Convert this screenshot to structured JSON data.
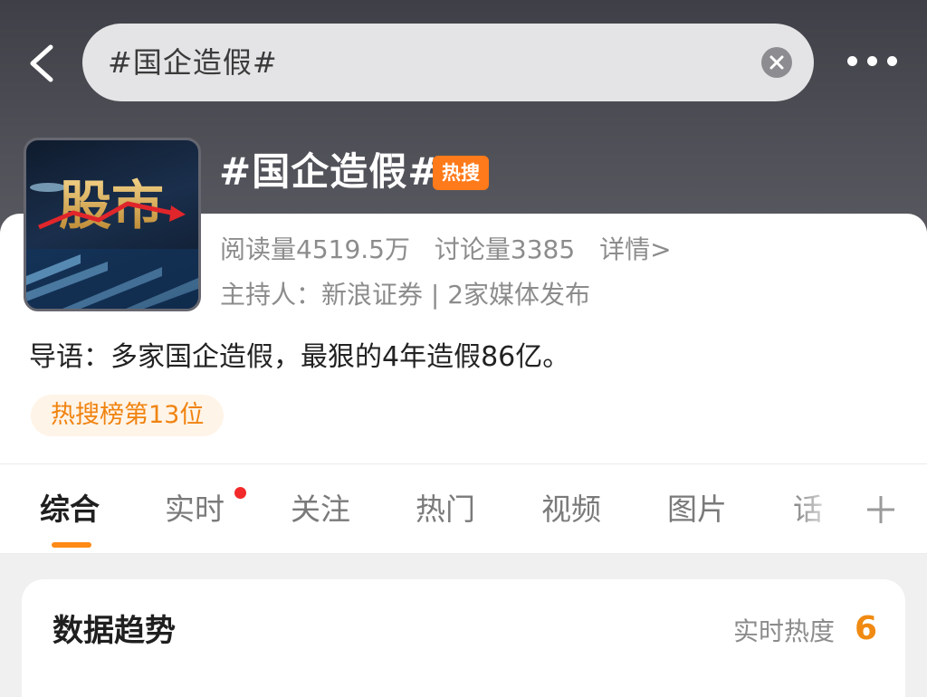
{
  "header": {
    "search_text": "#国企造假#",
    "back_icon": "chevron-left-icon",
    "clear_icon": "clear-circle-icon",
    "more_icon": "more-horizontal-icon"
  },
  "topic": {
    "title": "#国企造假#",
    "hot_badge": "热搜",
    "cover_text": "股市",
    "reads": "阅读量4519.5万",
    "discussions": "讨论量3385",
    "details_link": "详情>",
    "host_line": "主持人：新浪证券 | 2家媒体发布",
    "intro": "导语：多家国企造假，最狠的4年造假86亿。",
    "rank": "热搜榜第13位"
  },
  "tabs": [
    {
      "label": "综合",
      "active": true
    },
    {
      "label": "实时",
      "has_dot": true
    },
    {
      "label": "关注"
    },
    {
      "label": "热门"
    },
    {
      "label": "视频"
    },
    {
      "label": "图片"
    },
    {
      "label": "话"
    }
  ],
  "trend_card": {
    "title": "数据趋势",
    "heat_label": "实时热度",
    "heat_value": "6"
  },
  "colors": {
    "accent": "#ff7a1a",
    "header_bg": "#4a4b52",
    "notification_dot": "#f22a2a"
  }
}
